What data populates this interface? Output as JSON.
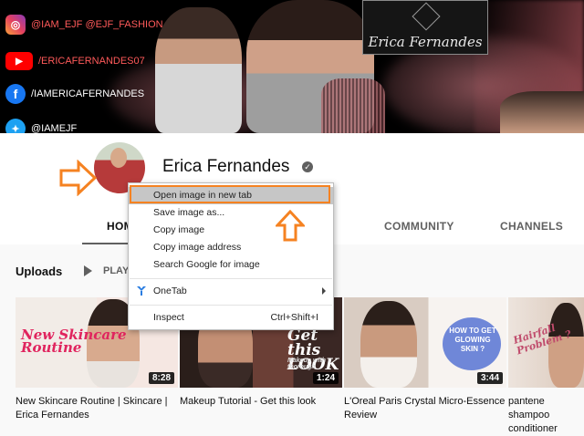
{
  "banner": {
    "social": [
      {
        "icon": "instagram-icon",
        "glyph": "◎",
        "text": "@IAM_EJF @EJF_FASHION"
      },
      {
        "icon": "youtube-icon",
        "glyph": "▶",
        "text": "/ERICAFERNANDES07"
      },
      {
        "icon": "facebook-icon",
        "glyph": "f",
        "text": "/IAMERICAFERNANDES"
      },
      {
        "icon": "twitter-icon",
        "glyph": "✦",
        "text": "@IAMEJF"
      }
    ],
    "logo_text": "Erica Fernandes"
  },
  "channel": {
    "name": "Erica Fernandes",
    "verified_glyph": "✓"
  },
  "tabs": {
    "home": "HOME",
    "community": "COMMUNITY",
    "channels": "CHANNELS"
  },
  "uploads": {
    "label": "Uploads",
    "play_all": "PLAY ALL"
  },
  "videos": [
    {
      "title": "New Skincare Routine | Skincare | Erica Fernandes",
      "duration": "8:28",
      "overlay": "New Skincare Routine",
      "overlay_sub": ""
    },
    {
      "title": "Makeup Tutorial - Get this look",
      "duration": "1:24",
      "overlay": "Get this LOOK",
      "overlay_sub": "Makeup with thorough"
    },
    {
      "title": "L'Oreal Paris Crystal Micro-Essence Review",
      "duration": "3:44",
      "overlay": "HOW TO GET GLOWING SKIN ?",
      "overlay_sub": ""
    },
    {
      "title": "pantene shampoo conditioner",
      "duration": "",
      "overlay": "Hairfall Problem ?",
      "overlay_sub": ""
    }
  ],
  "context_menu": {
    "items": [
      {
        "label": "Open image in new tab",
        "highlighted": true
      },
      {
        "label": "Save image as..."
      },
      {
        "label": "Copy image"
      },
      {
        "label": "Copy image address"
      },
      {
        "label": "Search Google for image"
      },
      {
        "label": "OneTab",
        "icon": "onetab-icon",
        "submenu": true
      },
      {
        "label": "Inspect",
        "shortcut": "Ctrl+Shift+I"
      }
    ]
  },
  "colors": {
    "annotation_orange": "#f58221",
    "menu_highlight": "#c6c6c6",
    "youtube_red": "#ff0000",
    "onetab_blue": "#2a7de1"
  }
}
